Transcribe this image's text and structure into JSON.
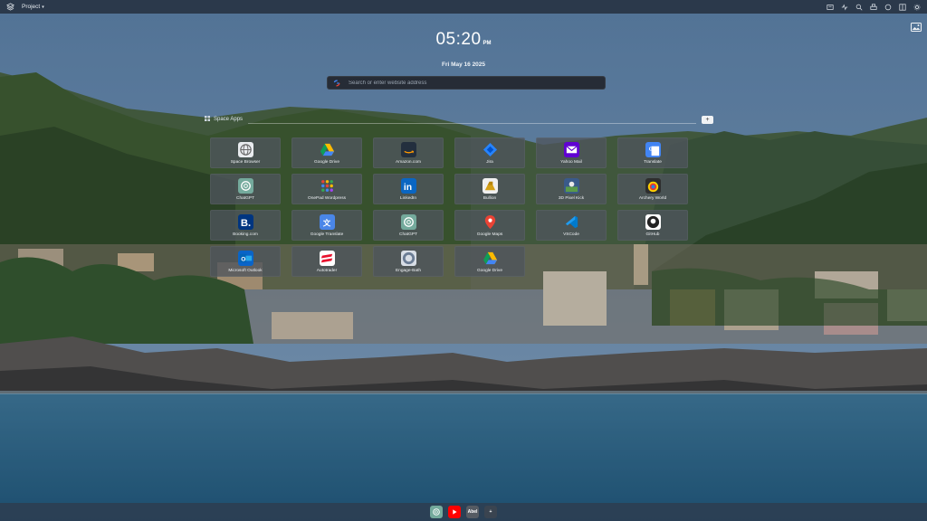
{
  "topbar": {
    "project_label": "Project",
    "tools": [
      "reader-icon",
      "activity-icon",
      "search-icon",
      "print-icon",
      "chat-icon",
      "sidebar-icon",
      "settings-icon"
    ]
  },
  "clock": {
    "time": "05:20",
    "ampm": "PM",
    "date": "Fri May 16 2025"
  },
  "search": {
    "placeholder": "Search or enter website address"
  },
  "space": {
    "title": "Space Apps",
    "add_label": "+"
  },
  "tiles": [
    {
      "label": "Space Browser",
      "icon": "globe-icon",
      "bg": "#e9ecef"
    },
    {
      "label": "Google Drive",
      "icon": "google-drive-icon",
      "bg": "transparent"
    },
    {
      "label": "Amazon.com",
      "icon": "amazon-icon",
      "bg": "#232f3e"
    },
    {
      "label": "Jira",
      "icon": "jira-icon",
      "bg": "transparent"
    },
    {
      "label": "Yahoo Mail",
      "icon": "yahoo-mail-icon",
      "bg": "#6001d2"
    },
    {
      "label": "Translate",
      "icon": "google-translate-icon",
      "bg": "#4285f4"
    },
    {
      "label": "ChatGPT",
      "icon": "chatgpt-icon",
      "bg": "#74aa9c"
    },
    {
      "label": "OnePad Wordpress",
      "icon": "grid-dots-icon",
      "bg": "transparent"
    },
    {
      "label": "LinkedIn",
      "icon": "linkedin-icon",
      "bg": "#0a66c2"
    },
    {
      "label": "Bullion",
      "icon": "bullion-icon",
      "bg": "#f0f0f0"
    },
    {
      "label": "3D Pixel Kick",
      "icon": "pixel-kick-icon",
      "bg": "#3a5a8a"
    },
    {
      "label": "Archery World",
      "icon": "archery-icon",
      "bg": "#2e2e2e"
    },
    {
      "label": "Booking.com",
      "icon": "booking-icon",
      "bg": "#003580"
    },
    {
      "label": "Google Translate",
      "icon": "translate-icon",
      "bg": "#4a86e8"
    },
    {
      "label": "ChatGPT",
      "icon": "chatgpt-icon",
      "bg": "#74aa9c"
    },
    {
      "label": "Google Maps",
      "icon": "google-maps-icon",
      "bg": "transparent"
    },
    {
      "label": "VSCode",
      "icon": "vscode-icon",
      "bg": "transparent"
    },
    {
      "label": "GitHub",
      "icon": "github-icon",
      "bg": "#ffffff"
    },
    {
      "label": "Microsoft Outlook",
      "icon": "outlook-icon",
      "bg": "#0a64c8"
    },
    {
      "label": "Autotrader",
      "icon": "autotrader-icon",
      "bg": "#ffffff"
    },
    {
      "label": "Engage-Bath",
      "icon": "engage-bath-icon",
      "bg": "#d8dee6"
    },
    {
      "label": "Google Drive",
      "icon": "google-drive-icon",
      "bg": "transparent"
    }
  ],
  "dock": [
    {
      "icon": "chatgpt-icon",
      "text": "",
      "bg": "#74aa9c"
    },
    {
      "icon": "youtube-icon",
      "text": "",
      "bg": "#ff0000"
    },
    {
      "icon": "abel-icon",
      "text": "Abel",
      "bg": "#555b63"
    },
    {
      "icon": "plus-icon",
      "text": "+",
      "bg": "#3a4450"
    }
  ],
  "colors": {
    "topbar": "#28344a",
    "tile": "#4e545c",
    "search": "#22262e"
  }
}
